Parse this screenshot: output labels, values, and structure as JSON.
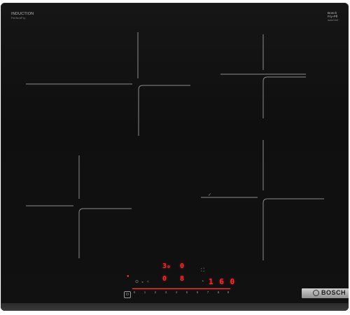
{
  "appliance": {
    "type_label": "INDUCTION",
    "type_sub": "PerfectFry",
    "system_label": "Bosch",
    "system_line2": "Fry-Pfl",
    "system_sub": "AutoChef"
  },
  "displays": {
    "zone_a": "3₀",
    "zone_b": "0",
    "zone_c": "0",
    "zone_d": "8",
    "timer": "1 6 0"
  },
  "controls": {
    "power_symbol": "⏻",
    "slider_steps": [
      "0",
      "1",
      "2",
      "3",
      "4",
      "5",
      "6",
      "7",
      "8",
      "9"
    ],
    "fry_icon": "⊙",
    "timer_icon": "◔"
  },
  "brand": {
    "name": "BOSCH"
  },
  "colors": {
    "glass": "#111111",
    "display_red": "#ff2b2b",
    "zone_lines": "#8d8d8d",
    "brand_plate": "#b0b0b0"
  }
}
